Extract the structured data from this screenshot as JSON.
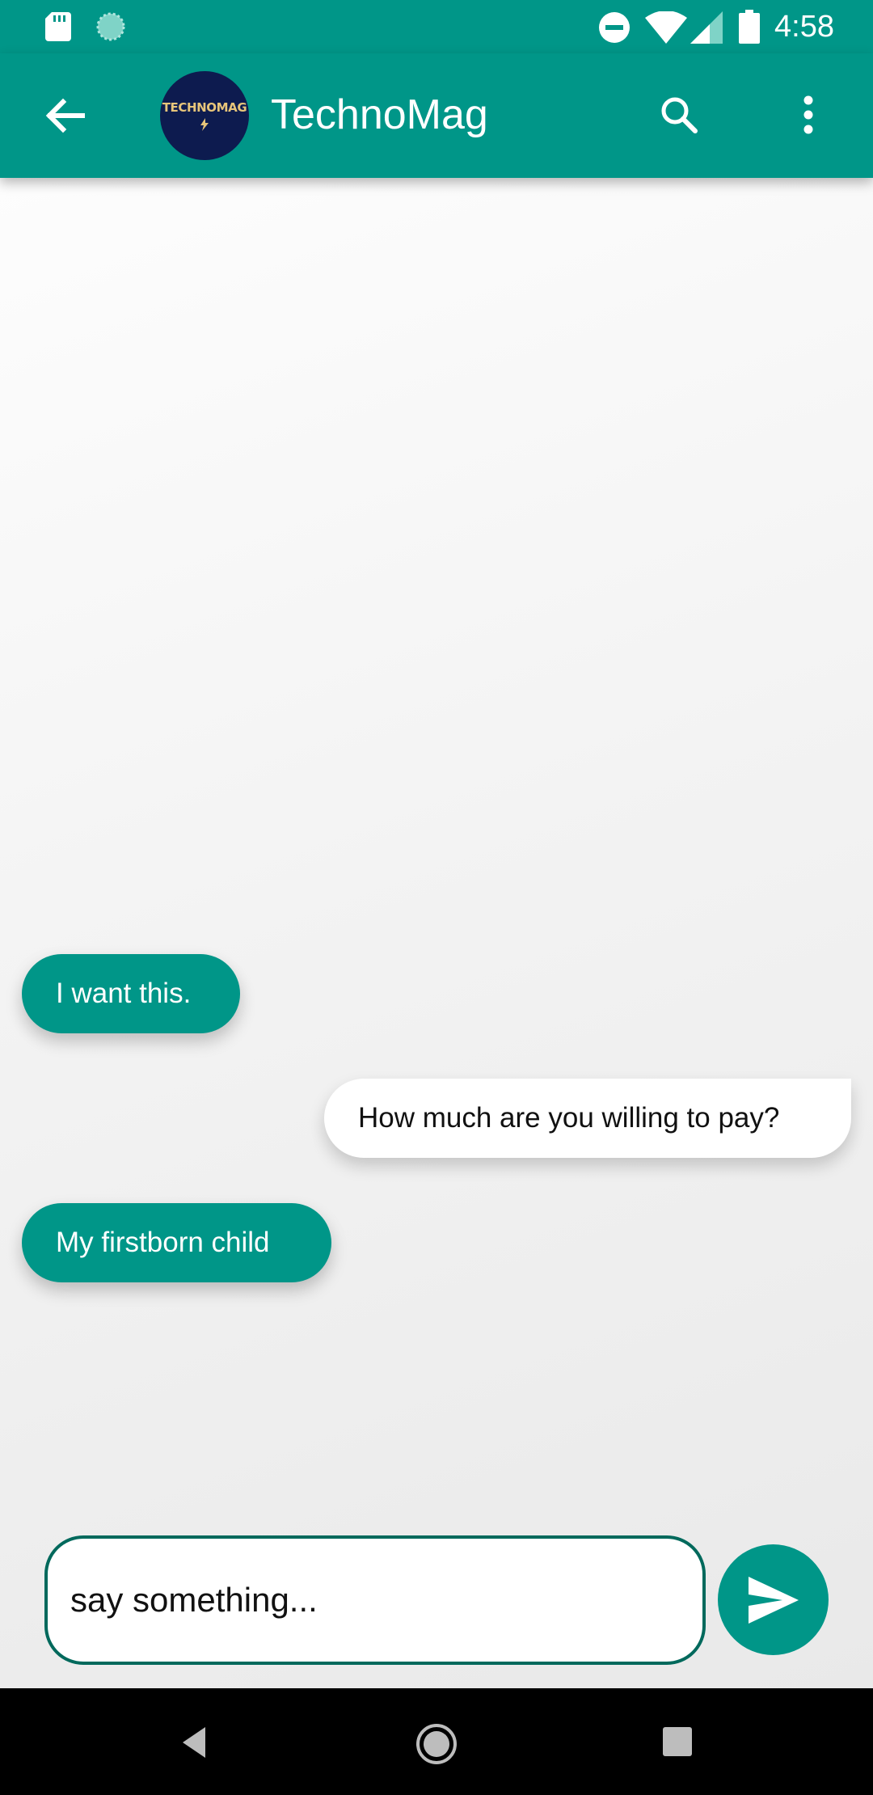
{
  "status_bar": {
    "time": "4:58",
    "icons": [
      "sd-card-icon",
      "sync-icon",
      "do-not-disturb-icon",
      "wifi-icon",
      "cell-signal-icon",
      "battery-icon"
    ]
  },
  "app_bar": {
    "title": "TechnoMag",
    "avatar_text": "TECHNOMAG",
    "icons": [
      "back-arrow-icon",
      "search-icon",
      "more-vert-icon"
    ],
    "color": "#009688"
  },
  "messages": [
    {
      "side": "incoming",
      "text": "I want this."
    },
    {
      "side": "outgoing",
      "text": "How much are you willing to pay?"
    },
    {
      "side": "incoming",
      "text": "My firstborn child"
    }
  ],
  "composer": {
    "placeholder": "say something...",
    "value": "",
    "send_icon": "send-icon"
  },
  "nav_bar": {
    "icons": [
      "nav-back-icon",
      "nav-home-icon",
      "nav-recents-icon"
    ]
  },
  "colors": {
    "primary": "#009688",
    "input_border": "#00695c",
    "outgoing_bubble": "#ffffff"
  }
}
